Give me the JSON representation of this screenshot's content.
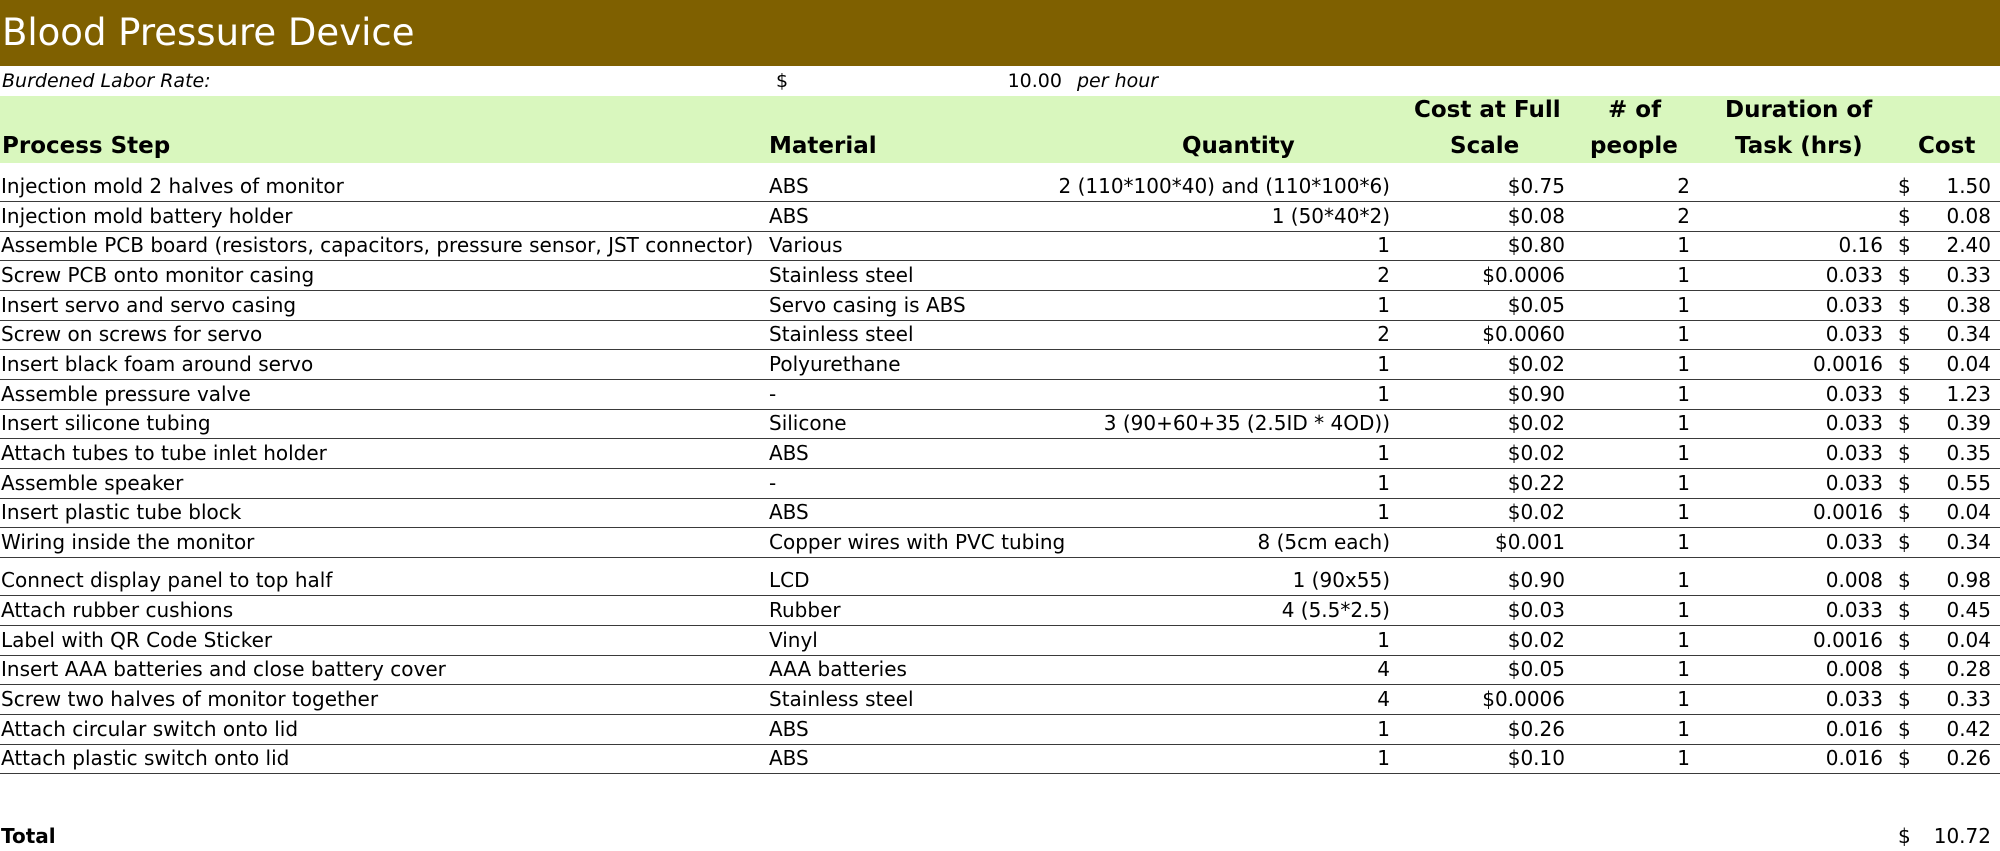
{
  "title": "Blood Pressure Device",
  "rate": {
    "label": "Burdened Labor Rate:",
    "currency": "$",
    "value": "10.00",
    "unit": "per hour"
  },
  "headers": {
    "process": "Process Step",
    "material": "Material",
    "quantity": "Quantity",
    "cost_full_1": "Cost at Full",
    "cost_full_2": "Scale",
    "people_1": "# of",
    "people_2": "people",
    "duration_1": "Duration of",
    "duration_2": "Task (hrs)",
    "cost": "Cost"
  },
  "rows": [
    {
      "step": "Injection mold 2 halves of monitor",
      "material": "ABS",
      "quantity": "2 (110*100*40) and (110*100*6)",
      "cost_full": "$0.75",
      "people": "2",
      "duration": "",
      "cur": "$",
      "cost": "1.50"
    },
    {
      "step": "Injection mold battery holder",
      "material": "ABS",
      "quantity": "1 (50*40*2)",
      "cost_full": "$0.08",
      "people": "2",
      "duration": "",
      "cur": "$",
      "cost": "0.08"
    },
    {
      "step": "Assemble PCB board (resistors, capacitors, pressure sensor, JST connector)",
      "material": "Various",
      "quantity": "1",
      "cost_full": "$0.80",
      "people": "1",
      "duration": "0.16",
      "cur": "$",
      "cost": "2.40"
    },
    {
      "step": "Screw PCB onto monitor casing",
      "material": "Stainless steel",
      "quantity": "2",
      "cost_full": "$0.0006",
      "people": "1",
      "duration": "0.033",
      "cur": "$",
      "cost": "0.33"
    },
    {
      "step": "Insert servo and servo casing",
      "material": "Servo casing is ABS",
      "quantity": "1",
      "cost_full": "$0.05",
      "people": "1",
      "duration": "0.033",
      "cur": "$",
      "cost": "0.38"
    },
    {
      "step": "Screw on screws for servo",
      "material": "Stainless steel",
      "quantity": "2",
      "cost_full": "$0.0060",
      "people": "1",
      "duration": "0.033",
      "cur": "$",
      "cost": "0.34"
    },
    {
      "step": "Insert black foam around servo",
      "material": "Polyurethane",
      "quantity": "1",
      "cost_full": "$0.02",
      "people": "1",
      "duration": "0.0016",
      "cur": "$",
      "cost": "0.04"
    },
    {
      "step": "Assemble pressure valve",
      "material": "-",
      "quantity": "1",
      "cost_full": "$0.90",
      "people": "1",
      "duration": "0.033",
      "cur": "$",
      "cost": "1.23"
    },
    {
      "step": "Insert silicone tubing",
      "material": "Silicone",
      "quantity": "3 (90+60+35 (2.5ID * 4OD))",
      "cost_full": "$0.02",
      "people": "1",
      "duration": "0.033",
      "cur": "$",
      "cost": "0.39"
    },
    {
      "step": "Attach tubes to tube inlet holder",
      "material": "ABS",
      "quantity": "1",
      "cost_full": "$0.02",
      "people": "1",
      "duration": "0.033",
      "cur": "$",
      "cost": "0.35"
    },
    {
      "step": "Assemble speaker",
      "material": "-",
      "quantity": "1",
      "cost_full": "$0.22",
      "people": "1",
      "duration": "0.033",
      "cur": "$",
      "cost": "0.55"
    },
    {
      "step": "Insert plastic tube block",
      "material": "ABS",
      "quantity": "1",
      "cost_full": "$0.02",
      "people": "1",
      "duration": "0.0016",
      "cur": "$",
      "cost": "0.04"
    },
    {
      "step": "Wiring inside the monitor",
      "material": "Copper wires with PVC tubing",
      "quantity": "8 (5cm each)",
      "cost_full": "$0.001",
      "people": "1",
      "duration": "0.033",
      "cur": "$",
      "cost": "0.34"
    },
    {
      "step": "Connect display panel to top half",
      "material": "LCD",
      "quantity": "1 (90x55)",
      "cost_full": "$0.90",
      "people": "1",
      "duration": "0.008",
      "cur": "$",
      "cost": "0.98"
    },
    {
      "step": "Attach rubber cushions",
      "material": "Rubber",
      "quantity": "4 (5.5*2.5)",
      "cost_full": "$0.03",
      "people": "1",
      "duration": "0.033",
      "cur": "$",
      "cost": "0.45"
    },
    {
      "step": "Label with QR Code Sticker",
      "material": "Vinyl",
      "quantity": "1",
      "cost_full": "$0.02",
      "people": "1",
      "duration": "0.0016",
      "cur": "$",
      "cost": "0.04"
    },
    {
      "step": "Insert AAA batteries and close battery cover",
      "material": "AAA batteries",
      "quantity": "4",
      "cost_full": "$0.05",
      "people": "1",
      "duration": "0.008",
      "cur": "$",
      "cost": "0.28"
    },
    {
      "step": "Screw two halves of monitor together",
      "material": "Stainless steel",
      "quantity": "4",
      "cost_full": "$0.0006",
      "people": "1",
      "duration": "0.033",
      "cur": "$",
      "cost": "0.33"
    },
    {
      "step": "Attach circular switch onto lid",
      "material": "ABS",
      "quantity": "1",
      "cost_full": "$0.26",
      "people": "1",
      "duration": "0.016",
      "cur": "$",
      "cost": "0.42"
    },
    {
      "step": "Attach plastic switch onto lid",
      "material": "ABS",
      "quantity": "1",
      "cost_full": "$0.10",
      "people": "1",
      "duration": "0.016",
      "cur": "$",
      "cost": "0.26"
    }
  ],
  "total": {
    "label": "Total",
    "cur": "$",
    "value": "10.72"
  }
}
